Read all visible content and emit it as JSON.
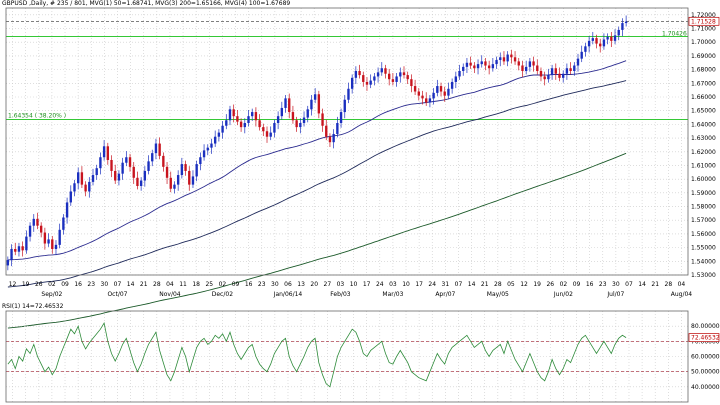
{
  "chart_data": [
    {
      "type": "candlestick",
      "title": "GBPUSD ,Daily, # 235 / 801, MVG(1) 50=1.68741, MVG(3) 200=1.65166, MVG(4) 100=1.67689",
      "symbol": "GBPUSD",
      "timeframe": "Daily",
      "ylim": [
        1.53,
        1.725
      ],
      "grid": true,
      "x_ticks_top": [
        "12",
        "19",
        "26",
        "02",
        "09",
        "16",
        "23",
        "30",
        "07",
        "14",
        "21",
        "28",
        "04",
        "11",
        "18",
        "25",
        "02",
        "09",
        "16",
        "23",
        "30",
        "06",
        "13",
        "20",
        "27",
        "03",
        "10",
        "17",
        "24",
        "03",
        "10",
        "17",
        "24",
        "31",
        "07",
        "14",
        "21",
        "28",
        "05",
        "12",
        "19",
        "26",
        "02",
        "09",
        "16",
        "23",
        "30",
        "07",
        "14",
        "21",
        "28",
        "04"
      ],
      "x_ticks_bottom": [
        "Sep/02",
        "Oct/07",
        "Nov/04",
        "Dec/02",
        "Jan/06/14",
        "Feb/03",
        "Mar/03",
        "Apr/07",
        "May/05",
        "Jun/02",
        "Jul/07",
        "Aug/04"
      ],
      "y_ticks": [
        "1.53000",
        "1.54000",
        "1.55000",
        "1.56000",
        "1.57000",
        "1.58000",
        "1.59000",
        "1.60000",
        "1.61000",
        "1.62000",
        "1.63000",
        "1.64000",
        "1.65000",
        "1.66000",
        "1.67000",
        "1.68000",
        "1.69000",
        "1.70000",
        "1.71000",
        "1.72000"
      ],
      "close_series": [
        1.541,
        1.549,
        1.547,
        1.551,
        1.548,
        1.558,
        1.566,
        1.571,
        1.566,
        1.561,
        1.553,
        1.556,
        1.549,
        1.552,
        1.563,
        1.572,
        1.583,
        1.591,
        1.597,
        1.605,
        1.596,
        1.591,
        1.598,
        1.603,
        1.608,
        1.616,
        1.624,
        1.614,
        1.606,
        1.599,
        1.604,
        1.612,
        1.616,
        1.609,
        1.601,
        1.595,
        1.599,
        1.606,
        1.613,
        1.619,
        1.626,
        1.617,
        1.609,
        1.601,
        1.593,
        1.596,
        1.603,
        1.611,
        1.606,
        1.596,
        1.602,
        1.611,
        1.616,
        1.621,
        1.623,
        1.626,
        1.631,
        1.634,
        1.639,
        1.643,
        1.651,
        1.646,
        1.642,
        1.638,
        1.641,
        1.646,
        1.649,
        1.643,
        1.638,
        1.635,
        1.631,
        1.634,
        1.641,
        1.646,
        1.652,
        1.659,
        1.649,
        1.643,
        1.638,
        1.641,
        1.645,
        1.651,
        1.658,
        1.662,
        1.648,
        1.639,
        1.631,
        1.627,
        1.633,
        1.641,
        1.649,
        1.658,
        1.666,
        1.674,
        1.679,
        1.676,
        1.671,
        1.669,
        1.672,
        1.675,
        1.678,
        1.681,
        1.677,
        1.673,
        1.671,
        1.675,
        1.678,
        1.676,
        1.673,
        1.668,
        1.664,
        1.661,
        1.659,
        1.656,
        1.659,
        1.663,
        1.668,
        1.664,
        1.661,
        1.666,
        1.671,
        1.675,
        1.679,
        1.682,
        1.685,
        1.683,
        1.681,
        1.684,
        1.686,
        1.683,
        1.681,
        1.684,
        1.687,
        1.689,
        1.686,
        1.691,
        1.689,
        1.686,
        1.683,
        1.679,
        1.682,
        1.686,
        1.683,
        1.679,
        1.675,
        1.673,
        1.676,
        1.681,
        1.677,
        1.674,
        1.677,
        1.681,
        1.679,
        1.683,
        1.688,
        1.693,
        1.697,
        1.701,
        1.703,
        1.699,
        1.697,
        1.702,
        1.704,
        1.701,
        1.705,
        1.709,
        1.714,
        1.715
      ],
      "last_price_label": "1.71528",
      "resistance_label": "1.70426",
      "fib_label": "1.64354 ( 38.20% )",
      "moving_averages": [
        {
          "period": 50,
          "value": 1.68741
        },
        {
          "period": 100,
          "value": 1.67689
        },
        {
          "period": 200,
          "value": 1.65166
        }
      ],
      "colors": {
        "up": "#1a2fbf",
        "down": "#c8141e",
        "ma50": "#2b2b8f",
        "ma100": "#1f2a5a",
        "ma200": "#1c5a2a",
        "hline": "#18c01a",
        "lastline": "#333333"
      }
    },
    {
      "type": "line",
      "title": "RSI(1) 14=72.46532",
      "ylim": [
        30,
        90
      ],
      "y_ticks": [
        "40.00000",
        "50.00000",
        "60.00000",
        "70.00000",
        "80.00000"
      ],
      "reference_lines": [
        70,
        50
      ],
      "last_value_label": "72.46532",
      "values": [
        55,
        58,
        52,
        60,
        57,
        65,
        62,
        68,
        60,
        55,
        50,
        53,
        48,
        52,
        60,
        66,
        72,
        78,
        75,
        80,
        70,
        65,
        69,
        72,
        75,
        78,
        82,
        70,
        62,
        57,
        62,
        68,
        72,
        64,
        56,
        50,
        55,
        62,
        68,
        72,
        76,
        64,
        56,
        48,
        44,
        50,
        58,
        66,
        60,
        50,
        58,
        66,
        70,
        72,
        68,
        70,
        74,
        72,
        75,
        70,
        76,
        68,
        62,
        58,
        62,
        66,
        68,
        60,
        55,
        52,
        50,
        55,
        62,
        66,
        70,
        72,
        60,
        54,
        50,
        55,
        60,
        66,
        70,
        72,
        56,
        48,
        42,
        40,
        50,
        60,
        66,
        70,
        74,
        78,
        76,
        70,
        62,
        60,
        64,
        66,
        68,
        70,
        62,
        56,
        55,
        60,
        64,
        60,
        56,
        50,
        48,
        46,
        45,
        44,
        50,
        56,
        62,
        58,
        55,
        62,
        66,
        68,
        70,
        72,
        74,
        70,
        66,
        68,
        70,
        64,
        60,
        64,
        66,
        68,
        62,
        70,
        64,
        58,
        54,
        50,
        56,
        62,
        56,
        50,
        46,
        44,
        50,
        58,
        52,
        48,
        52,
        58,
        56,
        62,
        68,
        72,
        74,
        70,
        66,
        62,
        66,
        70,
        66,
        62,
        68,
        72,
        74,
        72.47
      ],
      "color": "#2e8b3a"
    }
  ]
}
